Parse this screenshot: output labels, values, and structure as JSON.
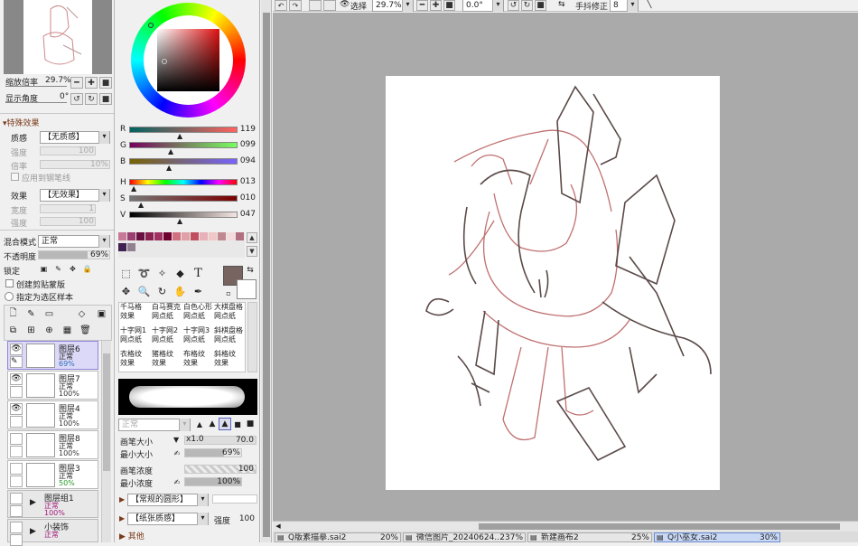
{
  "navigator": {
    "zoom_label": "缩放倍率",
    "zoom_value": "29.7%",
    "angle_label": "显示角度",
    "angle_value": "0°"
  },
  "effects": {
    "section": "特殊效果",
    "texture_label": "质感",
    "texture_value": "【无质感】",
    "strength_label": "强度",
    "strength_value": "100",
    "scale_label": "倍率",
    "scale_value": "10%",
    "brush_tex": "应用到钢笔线",
    "effect_label": "效果",
    "effect_value": "【无效果】",
    "width_label": "宽度",
    "width_value": "1",
    "strength2_label": "强度",
    "strength2_value": "100"
  },
  "blend": {
    "mode_label": "混合模式",
    "mode_value": "正常",
    "opacity_label": "不透明度",
    "opacity_value": "69%",
    "opacity_fraction": 0.69,
    "lock_label": "锁定",
    "clip_label": "创建剪贴蒙版",
    "sel_label": "指定为选区样本"
  },
  "layers": [
    {
      "name": "图层6",
      "mode": "正常",
      "opacity": "69%",
      "visible": true,
      "selected": true
    },
    {
      "name": "图层7",
      "mode": "正常",
      "opacity": "100%",
      "visible": true,
      "selected": false
    },
    {
      "name": "图层4",
      "mode": "正常",
      "opacity": "100%",
      "visible": true,
      "selected": false
    },
    {
      "name": "图层8",
      "mode": "正常",
      "opacity": "100%",
      "visible": false,
      "selected": false
    },
    {
      "name": "图层3",
      "mode": "正常",
      "opacity": "50%",
      "visible": false,
      "selected": false
    }
  ],
  "groups": [
    {
      "name": "图层组1",
      "mode": "正常",
      "opacity": "100%"
    },
    {
      "name": "小装饰",
      "mode": "正常",
      "opacity": ""
    }
  ],
  "color": {
    "r_label": "R",
    "r_value": "119",
    "g_label": "G",
    "g_value": "099",
    "b_label": "B",
    "b_value": "094",
    "h_label": "H",
    "h_value": "013",
    "s_label": "S",
    "s_value": "010",
    "v_label": "V",
    "v_value": "047",
    "current": "#776360"
  },
  "brushes": [
    {
      "l1": "千马格",
      "l2": "效果"
    },
    {
      "l1": "白马赛克",
      "l2": "网点纸"
    },
    {
      "l1": "白色心形",
      "l2": "网点纸"
    },
    {
      "l1": "大棋盘格",
      "l2": "网点纸"
    },
    {
      "l1": "十字网1",
      "l2": "网点纸"
    },
    {
      "l1": "十字网2",
      "l2": "网点纸"
    },
    {
      "l1": "十字网3",
      "l2": "网点纸"
    },
    {
      "l1": "斜棋盘格",
      "l2": "网点纸"
    },
    {
      "l1": "衣格纹",
      "l2": "效果"
    },
    {
      "l1": "猪格纹",
      "l2": "效果"
    },
    {
      "l1": "布格纹",
      "l2": "效果"
    },
    {
      "l1": "斜格纹",
      "l2": "效果"
    }
  ],
  "brush_settings": {
    "mode_value": "正常",
    "size_label": "画笔大小",
    "size_mult": "x1.0",
    "size_value": "70.0",
    "min_size_label": "最小大小",
    "min_size_value": "69%",
    "density_label": "画笔浓度",
    "density_value": "100",
    "min_density_label": "最小浓度",
    "min_density_value": "100%",
    "shape_value": "【常规的圆形】",
    "paper_value": "【纸张质感】",
    "paper_strength_label": "强度",
    "paper_strength_value": "100",
    "other_label": "其他"
  },
  "toolbar": {
    "select_label": "选择",
    "zoom_value": "29.7%",
    "angle_value": "0.0°",
    "stabilizer_label": "手抖修正",
    "stabilizer_value": "8"
  },
  "tabs": [
    {
      "name": "Q版素描摹.sai2",
      "zoom": "20%"
    },
    {
      "name": "微信图片_20240624...",
      "zoom": "237%"
    },
    {
      "name": "新建画布2",
      "zoom": "25%"
    },
    {
      "name": "Q小巫女.sai2",
      "zoom": "30%"
    }
  ],
  "colors": {
    "workspace": "#aaaaaa",
    "accent": "#3b78d0",
    "sketch_dark": "#5a4a48",
    "sketch_red": "#c07070"
  }
}
